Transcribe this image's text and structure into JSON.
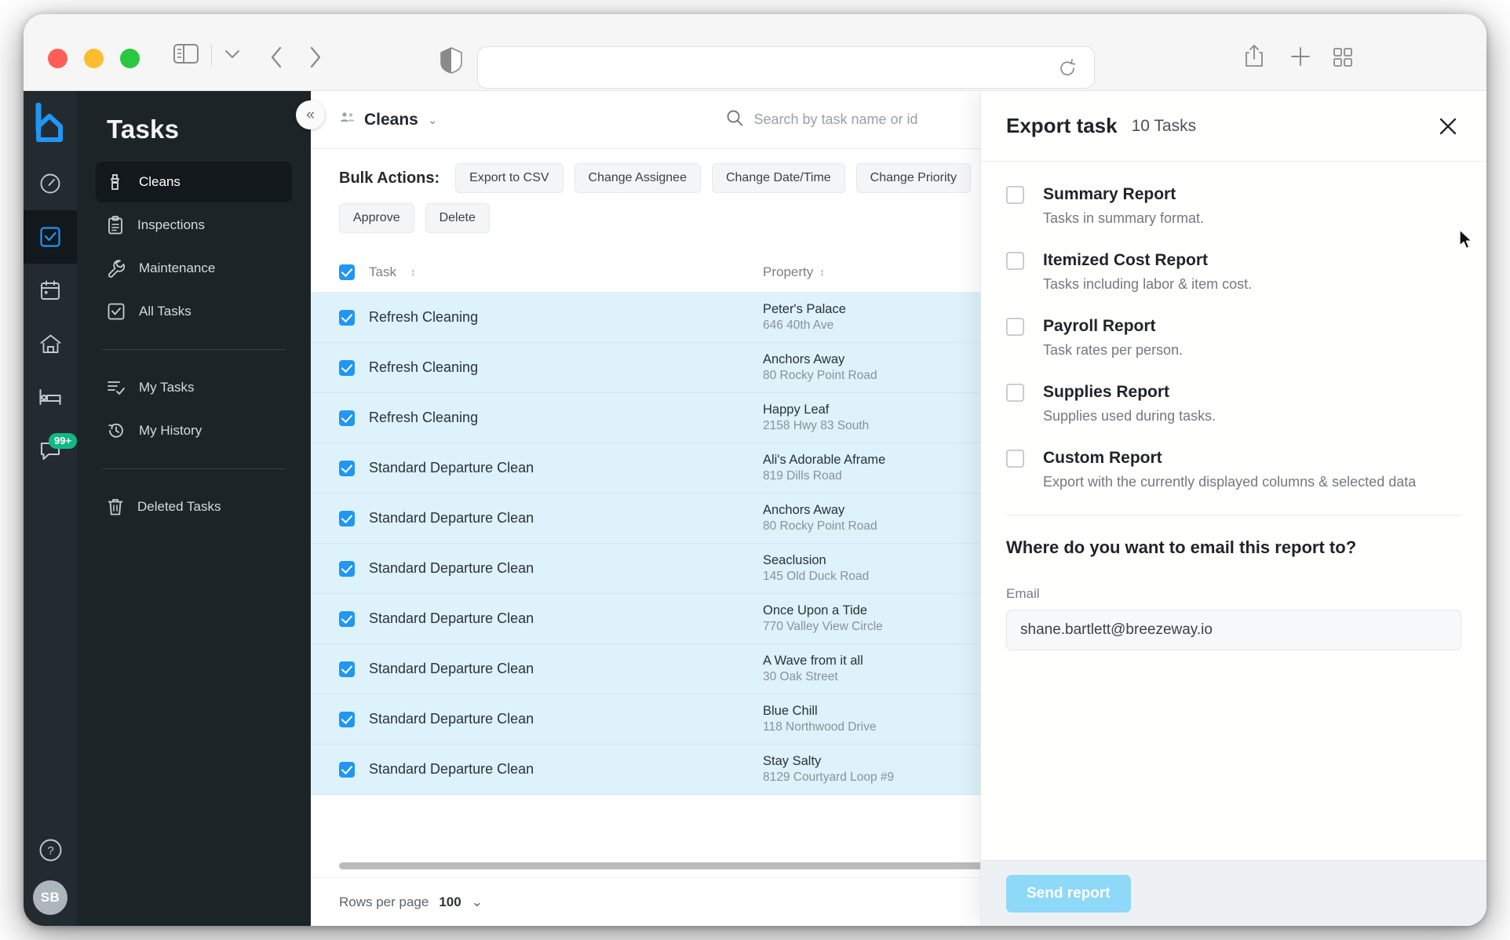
{
  "browser": {
    "url_value": "",
    "url_placeholder": "",
    "icons": {
      "sidebar": "sidebar-icon",
      "chevron_down": "chevron-down-icon",
      "back": "back-arrow-icon",
      "forward": "forward-arrow-icon",
      "shield": "shield-icon",
      "reload": "reload-icon",
      "share": "share-icon",
      "new_tab": "plus-icon",
      "tab_overview": "tab-overview-icon"
    }
  },
  "rail": {
    "logo": "breezeway-logo",
    "items": [
      {
        "icon": "gauge-icon",
        "name": "dashboard",
        "active": false
      },
      {
        "icon": "task-check-icon",
        "name": "tasks",
        "active": true
      },
      {
        "icon": "calendar-icon",
        "name": "calendar",
        "active": false
      },
      {
        "icon": "home-icon",
        "name": "properties",
        "active": false
      },
      {
        "icon": "bed-icon",
        "name": "reservations",
        "active": false
      },
      {
        "icon": "chat-icon",
        "name": "messages",
        "active": false,
        "badge": "99+"
      }
    ],
    "help_icon": "help-circle-icon",
    "avatar_initials": "SB"
  },
  "nav": {
    "title": "Tasks",
    "collapse_label": "«",
    "groups": [
      {
        "items": [
          {
            "label": "Cleans",
            "icon": "spray-bottle-icon",
            "active": true
          },
          {
            "label": "Inspections",
            "icon": "clipboard-icon",
            "active": false
          },
          {
            "label": "Maintenance",
            "icon": "wrench-icon",
            "active": false
          },
          {
            "label": "All Tasks",
            "icon": "checkbox-icon",
            "active": false
          }
        ]
      },
      {
        "items": [
          {
            "label": "My Tasks",
            "icon": "list-check-icon",
            "active": false
          },
          {
            "label": "My History",
            "icon": "history-icon",
            "active": false
          }
        ]
      },
      {
        "items": [
          {
            "label": "Deleted Tasks",
            "icon": "trash-icon",
            "active": false
          }
        ]
      }
    ]
  },
  "main": {
    "breadcrumb": "Cleans",
    "breadcrumb_icon": "people-icon",
    "breadcrumb_caret": "⌄",
    "search_icon": "search-icon",
    "search_placeholder": "Search by task name or id",
    "bulk_label": "Bulk Actions:",
    "bulk_actions_row1": [
      "Export to CSV",
      "Change Assignee",
      "Change Date/Time",
      "Change Priority"
    ],
    "bulk_actions_row2": [
      "Approve",
      "Delete"
    ],
    "columns": {
      "task": "Task",
      "property": "Property"
    },
    "rows": [
      {
        "task": "Refresh Cleaning",
        "property": "Peter's Palace",
        "address": "646 40th Ave",
        "checked": true
      },
      {
        "task": "Refresh Cleaning",
        "property": "Anchors Away",
        "address": "80 Rocky Point Road",
        "checked": true
      },
      {
        "task": "Refresh Cleaning",
        "property": "Happy Leaf",
        "address": "2158 Hwy 83 South",
        "checked": true
      },
      {
        "task": "Standard Departure Clean",
        "property": "Ali's Adorable Aframe",
        "address": "819 Dills Road",
        "checked": true
      },
      {
        "task": "Standard Departure Clean",
        "property": "Anchors Away",
        "address": "80 Rocky Point Road",
        "checked": true
      },
      {
        "task": "Standard Departure Clean",
        "property": "Seaclusion",
        "address": "145 Old Duck Road",
        "checked": true
      },
      {
        "task": "Standard Departure Clean",
        "property": "Once Upon a Tide",
        "address": "770 Valley View Circle",
        "checked": true
      },
      {
        "task": "Standard Departure Clean",
        "property": "A Wave from it all",
        "address": "30 Oak Street",
        "checked": true
      },
      {
        "task": "Standard Departure Clean",
        "property": "Blue Chill",
        "address": "118 Northwood Drive",
        "checked": true
      },
      {
        "task": "Standard Departure Clean",
        "property": "Stay Salty",
        "address": "8129 Courtyard Loop #9",
        "checked": true
      }
    ],
    "pager": {
      "label": "Rows per page",
      "value": "100",
      "caret": "⌄"
    }
  },
  "panel": {
    "title": "Export task",
    "count": "10 Tasks",
    "close_icon": "close-icon",
    "options": [
      {
        "title": "Summary Report",
        "desc": "Tasks in summary format.",
        "checked": false
      },
      {
        "title": "Itemized Cost Report",
        "desc": "Tasks including labor & item cost.",
        "checked": false
      },
      {
        "title": "Payroll Report",
        "desc": "Task rates per person.",
        "checked": false
      },
      {
        "title": "Supplies Report",
        "desc": "Supplies used during tasks.",
        "checked": false
      },
      {
        "title": "Custom Report",
        "desc": "Export with the currently displayed columns & selected data",
        "checked": false
      }
    ],
    "email_question": "Where do you want to email this report to?",
    "email_label": "Email",
    "email_value": "shane.bartlett@breezeway.io",
    "send_label": "Send report"
  },
  "colors": {
    "accent_blue": "#2196f3",
    "row_selected": "#ddf2fb",
    "rail_bg": "#242b30",
    "nav_bg": "#1d2427",
    "badge_green": "#12b886",
    "send_btn": "#8ed8f8"
  }
}
